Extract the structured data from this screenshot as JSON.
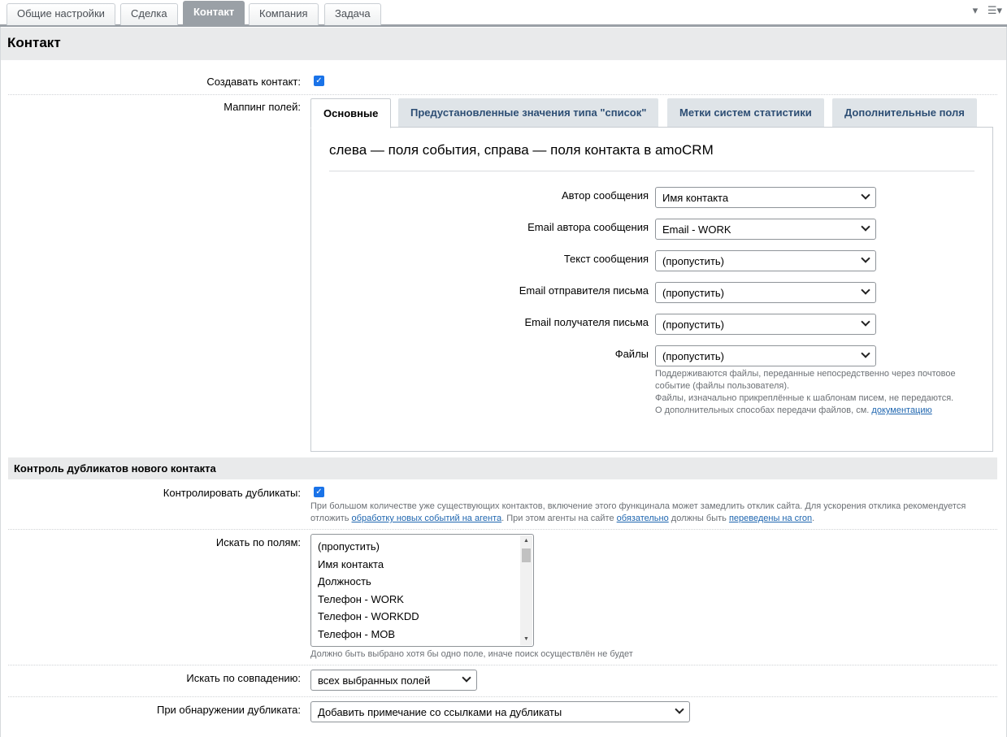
{
  "top_tabs": [
    "Общие настройки",
    "Сделка",
    "Контакт",
    "Компания",
    "Задача"
  ],
  "top_tabs_active_index": 2,
  "page_title": "Контакт",
  "create_contact": {
    "label": "Создавать контакт:",
    "checked": true
  },
  "mapping": {
    "label": "Маппинг полей:",
    "tabs": [
      "Основные",
      "Предустановленные значения типа \"список\"",
      "Метки систем статистики",
      "Дополнительные поля"
    ],
    "heading": "слева — поля события, справа — поля контакта в amoCRM",
    "rows": [
      {
        "label": "Автор сообщения",
        "value": "Имя контакта"
      },
      {
        "label": "Email автора сообщения",
        "value": "Email - WORK"
      },
      {
        "label": "Текст сообщения",
        "value": "(пропустить)"
      },
      {
        "label": "Email отправителя письма",
        "value": "(пропустить)"
      },
      {
        "label": "Email получателя письма",
        "value": "(пропустить)"
      },
      {
        "label": "Файлы",
        "value": "(пропустить)"
      }
    ],
    "files_hint": {
      "line1": "Поддерживаются файлы, переданные непосредственно через почтовое",
      "line2": "событие (файлы пользователя).",
      "line3": "Файлы, изначально прикреплённые к шаблонам писем, не передаются.",
      "line4": "О дополнительных способах передачи файлов, см.",
      "link": "документацию"
    }
  },
  "duplicates": {
    "section_title": "Контроль дубликатов нового контакта",
    "control_label": "Контролировать дубликаты:",
    "control_checked": true,
    "hint": {
      "line1": "При большом количестве уже существующих контактов, включение этого функцинала может замедлить отклик сайта. Для ускорения отклика рекомендуется",
      "pre": "отложить",
      "link1": "обработку новых событий на агента",
      "mid": ". При этом агенты на сайте",
      "link2": "обязательно",
      "mid2": "должны быть",
      "link3": "переведены на cron",
      "end": "."
    },
    "search_fields_label": "Искать по полям:",
    "search_fields_options": [
      "(пропустить)",
      "Имя контакта",
      "Должность",
      "Телефон - WORK",
      "Телефон - WORKDD",
      "Телефон - MOB"
    ],
    "search_fields_hint": "Должно быть выбрано хотя бы одно поле, иначе поиск осуществлён не будет",
    "match_label": "Искать по совпадению:",
    "match_value": "всех выбранных полей",
    "on_duplicate_label": "При обнаружении дубликата:",
    "on_duplicate_value": "Добавить примечание со ссылками на дубликаты"
  }
}
